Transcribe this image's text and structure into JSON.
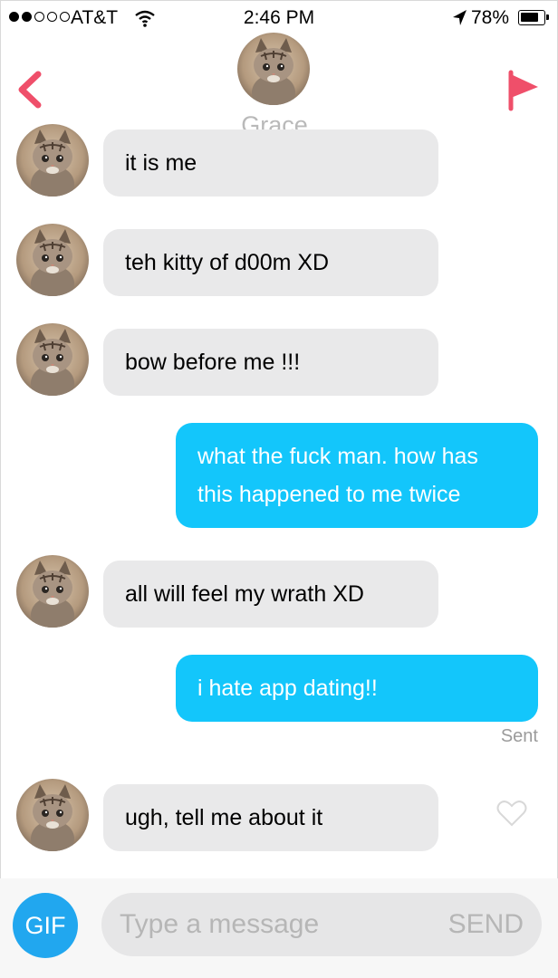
{
  "status_bar": {
    "carrier": "AT&T",
    "time": "2:46 PM",
    "battery": "78%",
    "signal_bars_filled": 2,
    "signal_bars_total": 5
  },
  "header": {
    "name": "Grace",
    "back_icon": "chevron-left-icon",
    "flag_icon": "flag-icon",
    "accent_color": "#ef4f6a"
  },
  "messages": [
    {
      "from": "them",
      "text": "it is me"
    },
    {
      "from": "them",
      "text": "teh kitty of d00m XD"
    },
    {
      "from": "them",
      "text": "bow before me !!!"
    },
    {
      "from": "me",
      "lines": [
        "what the fuck man. how has",
        "this happened to me twice"
      ]
    },
    {
      "from": "them",
      "text": "all will feel my wrath XD"
    },
    {
      "from": "me",
      "text": "i hate app dating!!"
    },
    {
      "from": "them",
      "text": "ugh, tell me about it"
    }
  ],
  "sent_label": "Sent",
  "composer": {
    "gif_label": "GIF",
    "placeholder": "Type a message",
    "send_label": "SEND"
  },
  "colors": {
    "outgoing_bubble": "#13c6fb",
    "incoming_bubble": "#e9e9ea",
    "gif_button": "#21a7ef"
  }
}
